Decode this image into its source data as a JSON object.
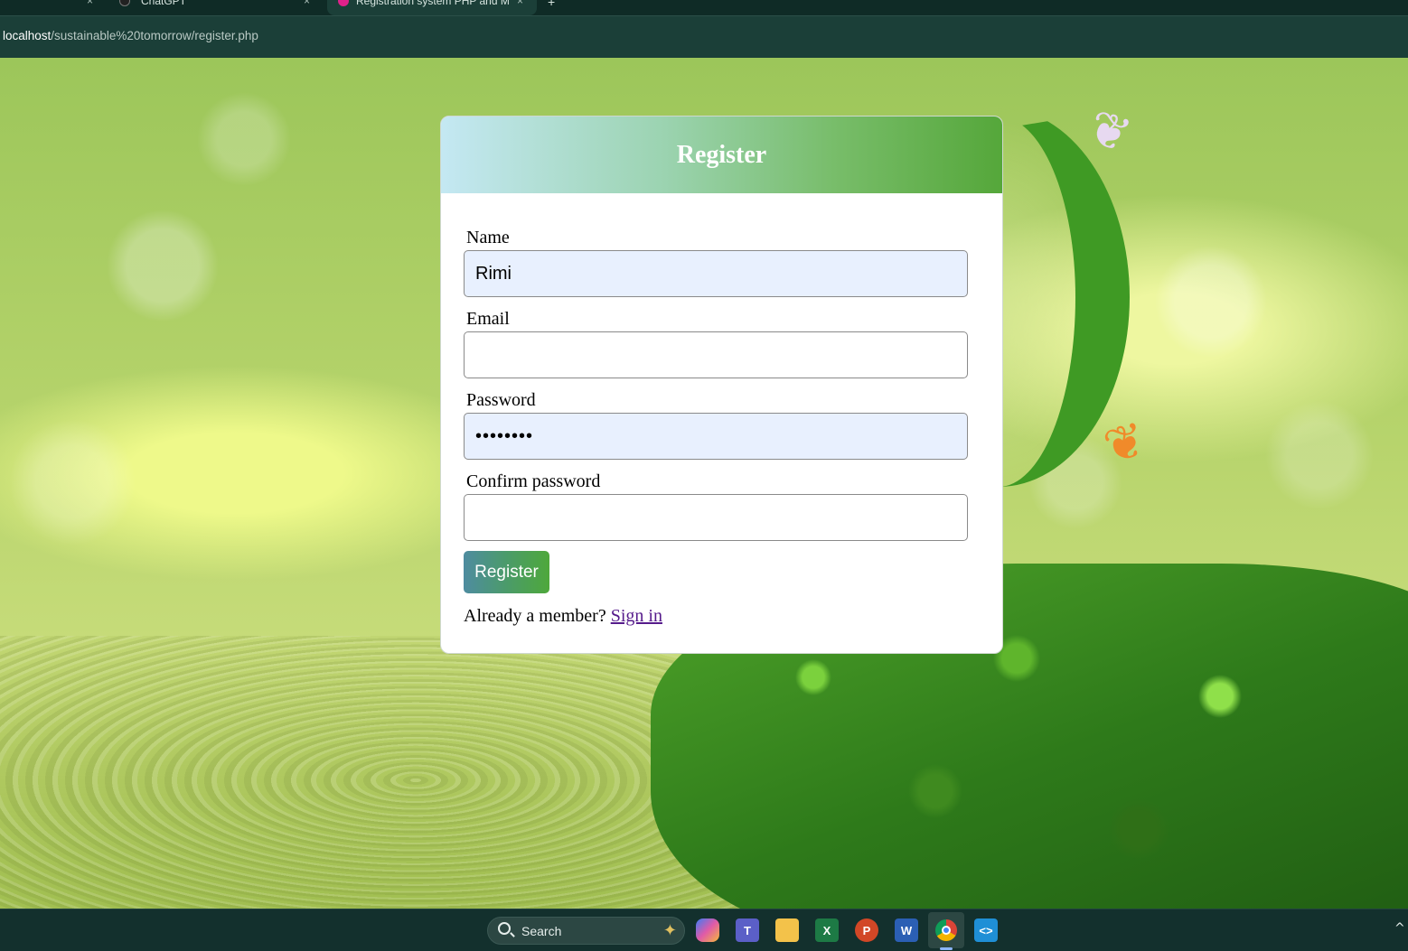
{
  "browser": {
    "tabs": [
      {
        "title": "",
        "active": false
      },
      {
        "title": "ChatGPT",
        "active": false
      },
      {
        "title": "Registration system PHP and M",
        "active": true
      }
    ],
    "close_glyph": "×",
    "new_tab_glyph": "+",
    "url_host": "localhost",
    "url_path": "/sustainable%20tomorrow/register.php"
  },
  "page": {
    "title": "Register",
    "fields": [
      {
        "label": "Name",
        "value": "Rimi",
        "type": "text",
        "autofilled": true
      },
      {
        "label": "Email",
        "value": "",
        "type": "email",
        "autofilled": false
      },
      {
        "label": "Password",
        "value": "........",
        "type": "password",
        "autofilled": true
      },
      {
        "label": "Confirm password",
        "value": "",
        "type": "password",
        "autofilled": false
      }
    ],
    "submit_label": "Register",
    "signin_prompt": "Already a member?",
    "signin_link": "Sign in",
    "colors": {
      "header_gradient_start": "#c4e8f3",
      "header_gradient_end": "#55a73a",
      "autofill_bg": "#e8f0fe",
      "link_visited": "#551a8b"
    }
  },
  "taskbar": {
    "search_label": "Search",
    "icons": [
      "windows-start-icon",
      "copilot-icon",
      "teams-icon",
      "file-explorer-icon",
      "excel-icon",
      "powerpoint-icon",
      "word-icon",
      "chrome-icon",
      "vscode-icon"
    ],
    "tray_chevron": "^"
  }
}
